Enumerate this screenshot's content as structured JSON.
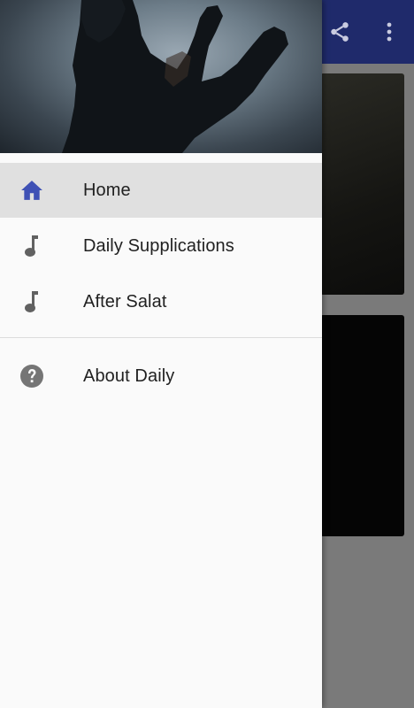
{
  "nav": {
    "items": [
      {
        "label": "Home",
        "icon": "home-icon",
        "active": true
      },
      {
        "label": "Daily Supplications",
        "icon": "music-note-icon",
        "active": false
      },
      {
        "label": "After Salat",
        "icon": "music-note-icon",
        "active": false
      }
    ],
    "secondary": [
      {
        "label": "About Daily",
        "icon": "help-icon"
      }
    ]
  },
  "colors": {
    "toolbar": "#1f2a6b",
    "active_icon": "#3f51b5",
    "inactive_icon": "#616161",
    "drawer_bg": "#fafafa",
    "active_row": "#e0e0e0"
  }
}
